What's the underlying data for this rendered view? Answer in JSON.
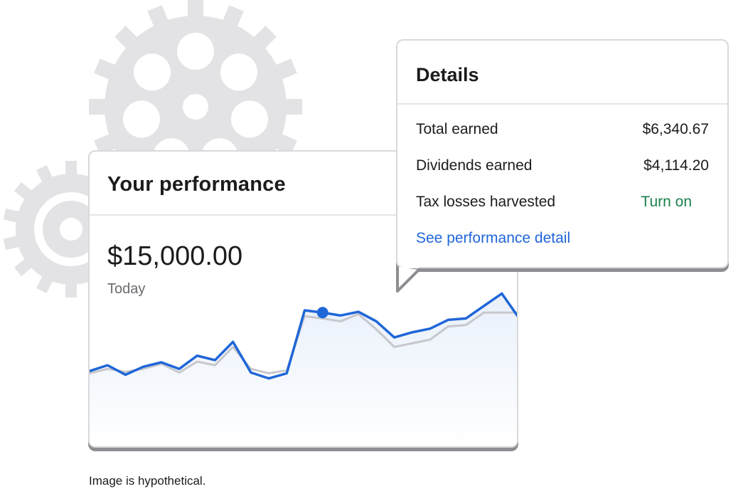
{
  "performance": {
    "title": "Your performance",
    "value": "$15,000.00",
    "date_label": "Today"
  },
  "details": {
    "title": "Details",
    "rows": [
      {
        "label": "Total earned",
        "value": "$6,340.67"
      },
      {
        "label": "Dividends earned",
        "value": "$4,114.20"
      },
      {
        "label": "Tax losses harvested",
        "value": "Turn on"
      }
    ],
    "link": "See performance detail"
  },
  "caption": "Image is hypothetical.",
  "colors": {
    "primary_line": "#1f66d8",
    "comparison_line": "#c7c7cc",
    "area_fill": "#e9f0fb",
    "turn_on": "#1a7f4b",
    "link": "#1f66d8",
    "gear": "#e3e3e6"
  },
  "icons": [
    "gear-icon-large",
    "gear-icon-small"
  ],
  "chart_data": {
    "type": "line",
    "series": [
      {
        "values": [
          0,
          0.8,
          -0.5,
          0.6,
          1.2,
          0.3,
          2.1,
          1.5,
          4.0,
          -0.2,
          -1.0,
          -0.3,
          8.3,
          8.0,
          7.6,
          8.1,
          6.8,
          4.6,
          5.3,
          5.8,
          7.0,
          7.2,
          8.9,
          10.6,
          7.1
        ]
      },
      {
        "values": [
          -0.3,
          0.3,
          -0.1,
          0.3,
          1.0,
          -0.2,
          1.3,
          0.8,
          3.3,
          0.3,
          -0.3,
          0.1,
          7.5,
          7.2,
          6.8,
          7.8,
          5.7,
          3.3,
          3.8,
          4.3,
          6.1,
          6.3,
          8.0,
          8.0,
          8.0
        ]
      }
    ],
    "highlight_index": 13,
    "ylim": [
      -6,
      12
    ]
  }
}
